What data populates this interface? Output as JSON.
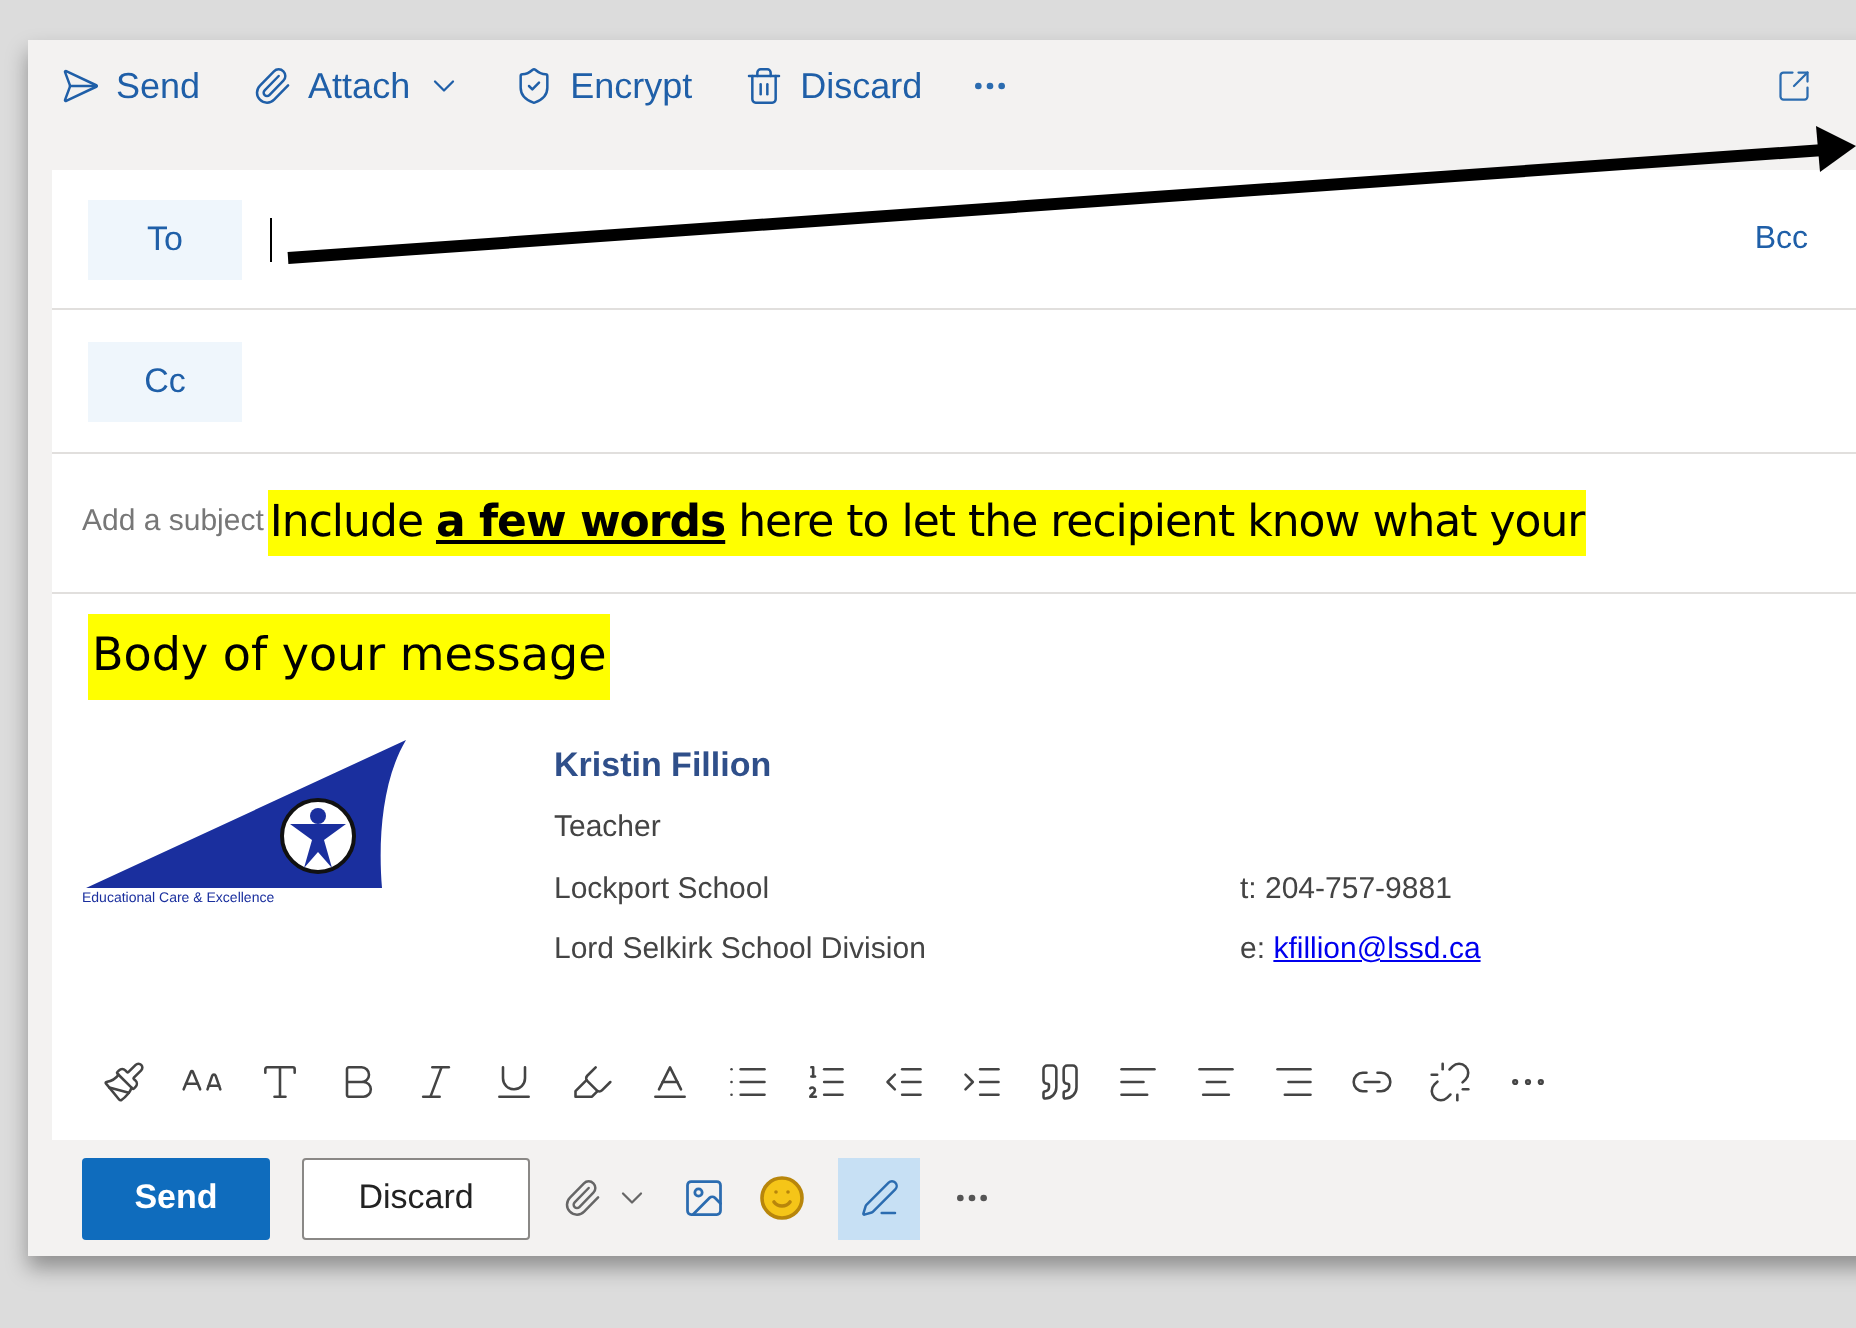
{
  "toolbar": {
    "items": [
      {
        "kind": "send",
        "label": "Send"
      },
      {
        "kind": "attach",
        "label": "Attach"
      },
      {
        "kind": "encrypt",
        "label": "Encrypt"
      },
      {
        "kind": "discard",
        "label": "Discard"
      }
    ]
  },
  "recipients": {
    "to_label": "To",
    "bcc_label": "Bcc",
    "cc_label": "Cc"
  },
  "subject": {
    "placeholder": "Add a subject",
    "annotation": "Include **a few words** here to let the recipient know what your"
  },
  "body": {
    "annotation": "Body of your message"
  },
  "signature": {
    "logo_caption": "Educational Care & Excellence",
    "name": "Kristin Fillion",
    "lines": [
      "Teacher",
      "Lockport School",
      "Lord Selkirk School Division"
    ],
    "phone": "t: 204-757-9881",
    "email_prefix": "e: ",
    "email": "kfillion@lssd.ca"
  },
  "bottom_bar": {
    "send": "Send",
    "discard": "Discard",
    "editor_selected": true
  }
}
